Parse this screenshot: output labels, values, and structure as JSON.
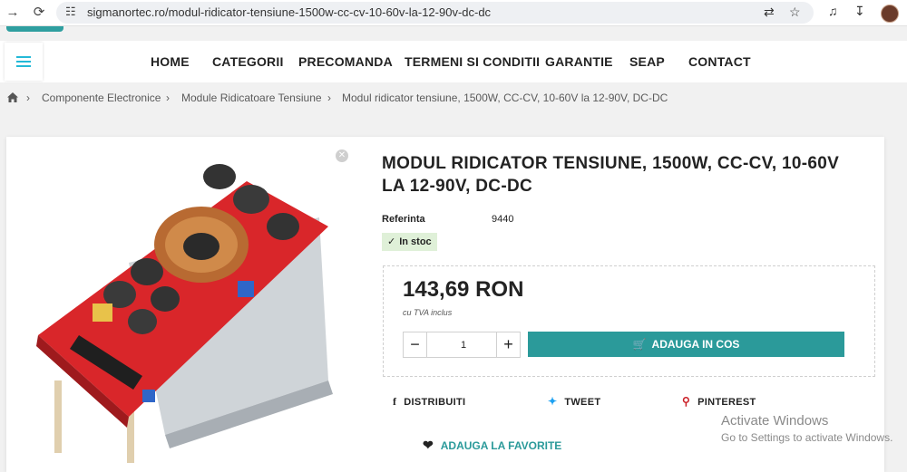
{
  "browser": {
    "url": "sigmanortec.ro/modul-ridicator-tensiune-1500w-cc-cv-10-60v-la-12-90v-dc-dc",
    "icons": [
      "back-arrow-icon",
      "reload-icon",
      "site-settings-icon",
      "translate-icon",
      "bookmark-star-icon",
      "media-control-icon",
      "download-icon",
      "profile-avatar-icon"
    ]
  },
  "nav": {
    "items": [
      "HOME",
      "CATEGORII",
      "PRECOMANDA",
      "TERMENI SI CONDITII",
      "GARANTIE",
      "SEAP",
      "CONTACT"
    ]
  },
  "breadcrumb": {
    "items": [
      "Componente Electronice",
      "Module Ridicatoare Tensiune",
      "Modul ridicator tensiune, 1500W, CC-CV, 10-60V la 12-90V, DC-DC"
    ]
  },
  "product": {
    "title": "MODUL RIDICATOR TENSIUNE, 1500W, CC-CV, 10-60V LA 12-90V, DC-DC",
    "ref_label": "Referinta",
    "ref_value": "9440",
    "stock": "In stoc",
    "price": "143,69 RON",
    "tax_note": "cu TVA inclus",
    "quantity": "1",
    "add_to_cart": "ADAUGA IN COS",
    "share": {
      "facebook": "DISTRIBUITI",
      "twitter": "TWEET",
      "pinterest": "PINTEREST"
    },
    "favorite": "ADAUGA LA FAVORITE"
  },
  "overlay": {
    "activate_title": "Activate Windows",
    "activate_sub": "Go to Settings to activate Windows."
  },
  "colors": {
    "accent": "#2b9a9a",
    "stock_bg": "#dff0d8",
    "menu_icon": "#24b9d7"
  }
}
